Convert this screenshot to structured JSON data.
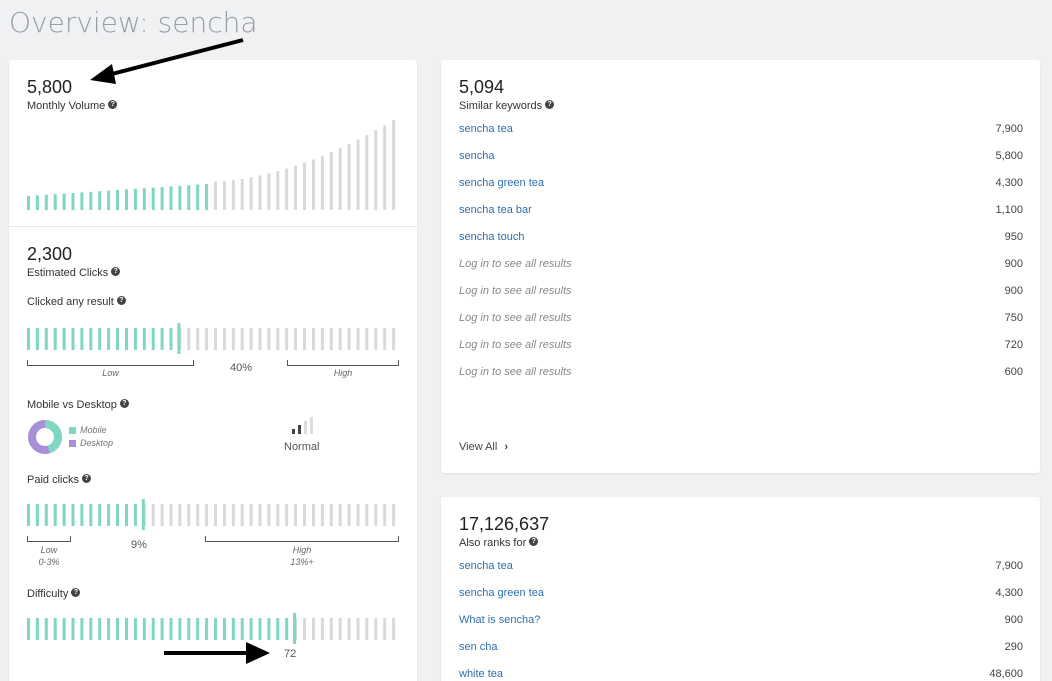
{
  "page": {
    "title": "Overview: sencha"
  },
  "monthly_volume": {
    "value": "5,800",
    "label": "Monthly Volume"
  },
  "estimated_clicks": {
    "value": "2,300",
    "label": "Estimated Clicks"
  },
  "clicked_any_result": {
    "label": "Clicked any result",
    "percent": "40%",
    "low": "Low",
    "high": "High",
    "level": 0.4
  },
  "mobile_vs_desktop": {
    "label": "Mobile vs Desktop",
    "mobile": "Mobile",
    "desktop": "Desktop",
    "mobile_share": 0.45,
    "signal": "Normal"
  },
  "paid_clicks": {
    "label": "Paid clicks",
    "percent": "9%",
    "low": "Low",
    "low_range": "0-3%",
    "high": "High",
    "high_range": "13%+",
    "level": 0.31
  },
  "difficulty": {
    "label": "Difficulty",
    "value": "72",
    "level": 0.72
  },
  "similar_keywords": {
    "count": "5,094",
    "label": "Similar keywords",
    "rows": [
      {
        "kw": "sencha tea",
        "val": "7,900",
        "muted": false
      },
      {
        "kw": "sencha",
        "val": "5,800",
        "muted": false
      },
      {
        "kw": "sencha green tea",
        "val": "4,300",
        "muted": false
      },
      {
        "kw": "sencha tea bar",
        "val": "1,100",
        "muted": false
      },
      {
        "kw": "sencha touch",
        "val": "950",
        "muted": false
      },
      {
        "kw": "Log in to see all results",
        "val": "900",
        "muted": true
      },
      {
        "kw": "Log in to see all results",
        "val": "900",
        "muted": true
      },
      {
        "kw": "Log in to see all results",
        "val": "750",
        "muted": true
      },
      {
        "kw": "Log in to see all results",
        "val": "720",
        "muted": true
      },
      {
        "kw": "Log in to see all results",
        "val": "600",
        "muted": true
      }
    ],
    "view_all": "View All"
  },
  "also_ranks_for": {
    "count": "17,126,637",
    "label": "Also ranks for",
    "rows": [
      {
        "kw": "sencha tea",
        "val": "7,900"
      },
      {
        "kw": "sencha green tea",
        "val": "4,300"
      },
      {
        "kw": "What is sencha?",
        "val": "900"
      },
      {
        "kw": "sen cha",
        "val": "290"
      },
      {
        "kw": "white tea",
        "val": "48,600"
      }
    ]
  },
  "colors": {
    "teal": "#7fd6c2",
    "gray": "#d9d9d9",
    "purple": "#a98fd8"
  }
}
